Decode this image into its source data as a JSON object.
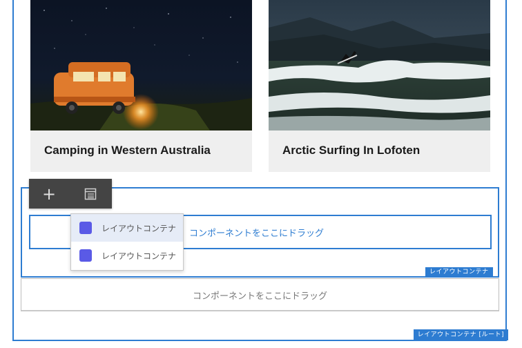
{
  "cards": [
    {
      "title": "Camping in Western Australia"
    },
    {
      "title": "Arctic Surfing In Lofoten"
    }
  ],
  "toolbar": {
    "add_icon": "plus-icon",
    "list_icon": "table-list-icon"
  },
  "dropzones": {
    "active_text": "コンポーネントをここにドラッグ",
    "plain_text": "コンポーネントをここにドラッグ"
  },
  "popup": {
    "items": [
      {
        "label": "レイアウトコンテナ",
        "color": "#5a5ae6"
      },
      {
        "label": "レイアウトコンテナ",
        "color": "#5a5ae6"
      }
    ]
  },
  "badges": {
    "container": "レイアウトコンテナ",
    "root": "レイアウトコンテナ [ルート]"
  },
  "colors": {
    "accent": "#2d7cd1",
    "toolbar": "#444444"
  }
}
